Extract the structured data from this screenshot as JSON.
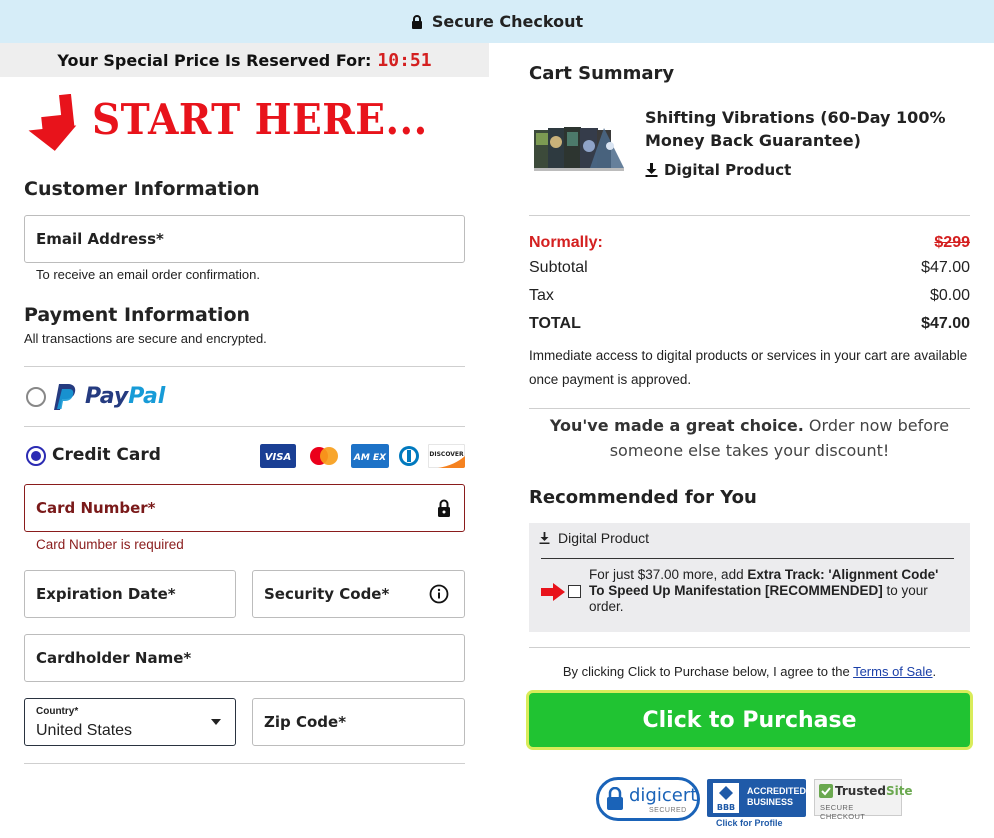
{
  "header": {
    "title": "Secure Checkout"
  },
  "timer": {
    "label": "Your Special Price Is Reserved For:",
    "value": "10:51"
  },
  "banner": {
    "text": "START HERE..."
  },
  "customer": {
    "title": "Customer Information",
    "email_label": "Email Address*",
    "email_note": "To receive an email order confirmation."
  },
  "payment": {
    "title": "Payment Information",
    "subtitle": "All transactions are secure and encrypted.",
    "paypal": {
      "word1": "Pay",
      "word2": "Pal",
      "selected": false
    },
    "credit_card": {
      "label": "Credit Card",
      "selected": true,
      "brands": [
        "VISA",
        "Mastercard",
        "AMEX",
        "Diners Club",
        "DISCOVER"
      ],
      "visa_text": "VISA",
      "amex_text": "AM EX",
      "discover_text": "DISCOVER"
    },
    "card_number_label": "Card Number*",
    "card_number_error": "Card Number is required",
    "expiration_label": "Expiration Date*",
    "security_label": "Security Code*",
    "cardholder_label": "Cardholder Name*",
    "country_label": "Country*",
    "country_value": "United States",
    "zip_label": "Zip Code*"
  },
  "cart": {
    "title": "Cart Summary",
    "product_name": "Shifting Vibrations (60-Day 100% Money Back Guarantee)",
    "product_type": "Digital Product",
    "normally_label": "Normally:",
    "normally_value": "$299",
    "subtotal_label": "Subtotal",
    "subtotal_value": "$47.00",
    "tax_label": "Tax",
    "tax_value": "$0.00",
    "total_label": "TOTAL",
    "total_value": "$47.00",
    "access_note": "Immediate access to digital products or services in your cart are available once payment is approved."
  },
  "choice": {
    "bold": "You've made a great choice.",
    "rest": " Order now before someone else takes your discount!"
  },
  "recommended": {
    "title": "Recommended for You",
    "type": "Digital Product",
    "text_pre": "For just $37.00 more, add ",
    "text_bold": "Extra Track: 'Alignment Code' To Speed Up Manifestation [RECOMMENDED]",
    "text_post": " to your order."
  },
  "terms": {
    "pre": "By clicking Click to Purchase below, I agree to the ",
    "link": "Terms of Sale",
    "post": "."
  },
  "purchase_button": "Click to Purchase",
  "badges": {
    "digicert": "digicert",
    "digicert_sub": "SECURED",
    "bbb_line1": "ACCREDITED",
    "bbb_line2": "BUSINESS",
    "bbb_small": "BBB",
    "bbb_footer": "Click for Profile",
    "trusted_a": "Trusted",
    "trusted_b": "Site",
    "trusted_sub": "SECURE CHECKOUT"
  },
  "colors": {
    "accent_red": "#e8131b",
    "button_green": "#20c332",
    "paypal_dark": "#253b80",
    "paypal_light": "#179bd7",
    "topbar": "#d6edf8"
  }
}
